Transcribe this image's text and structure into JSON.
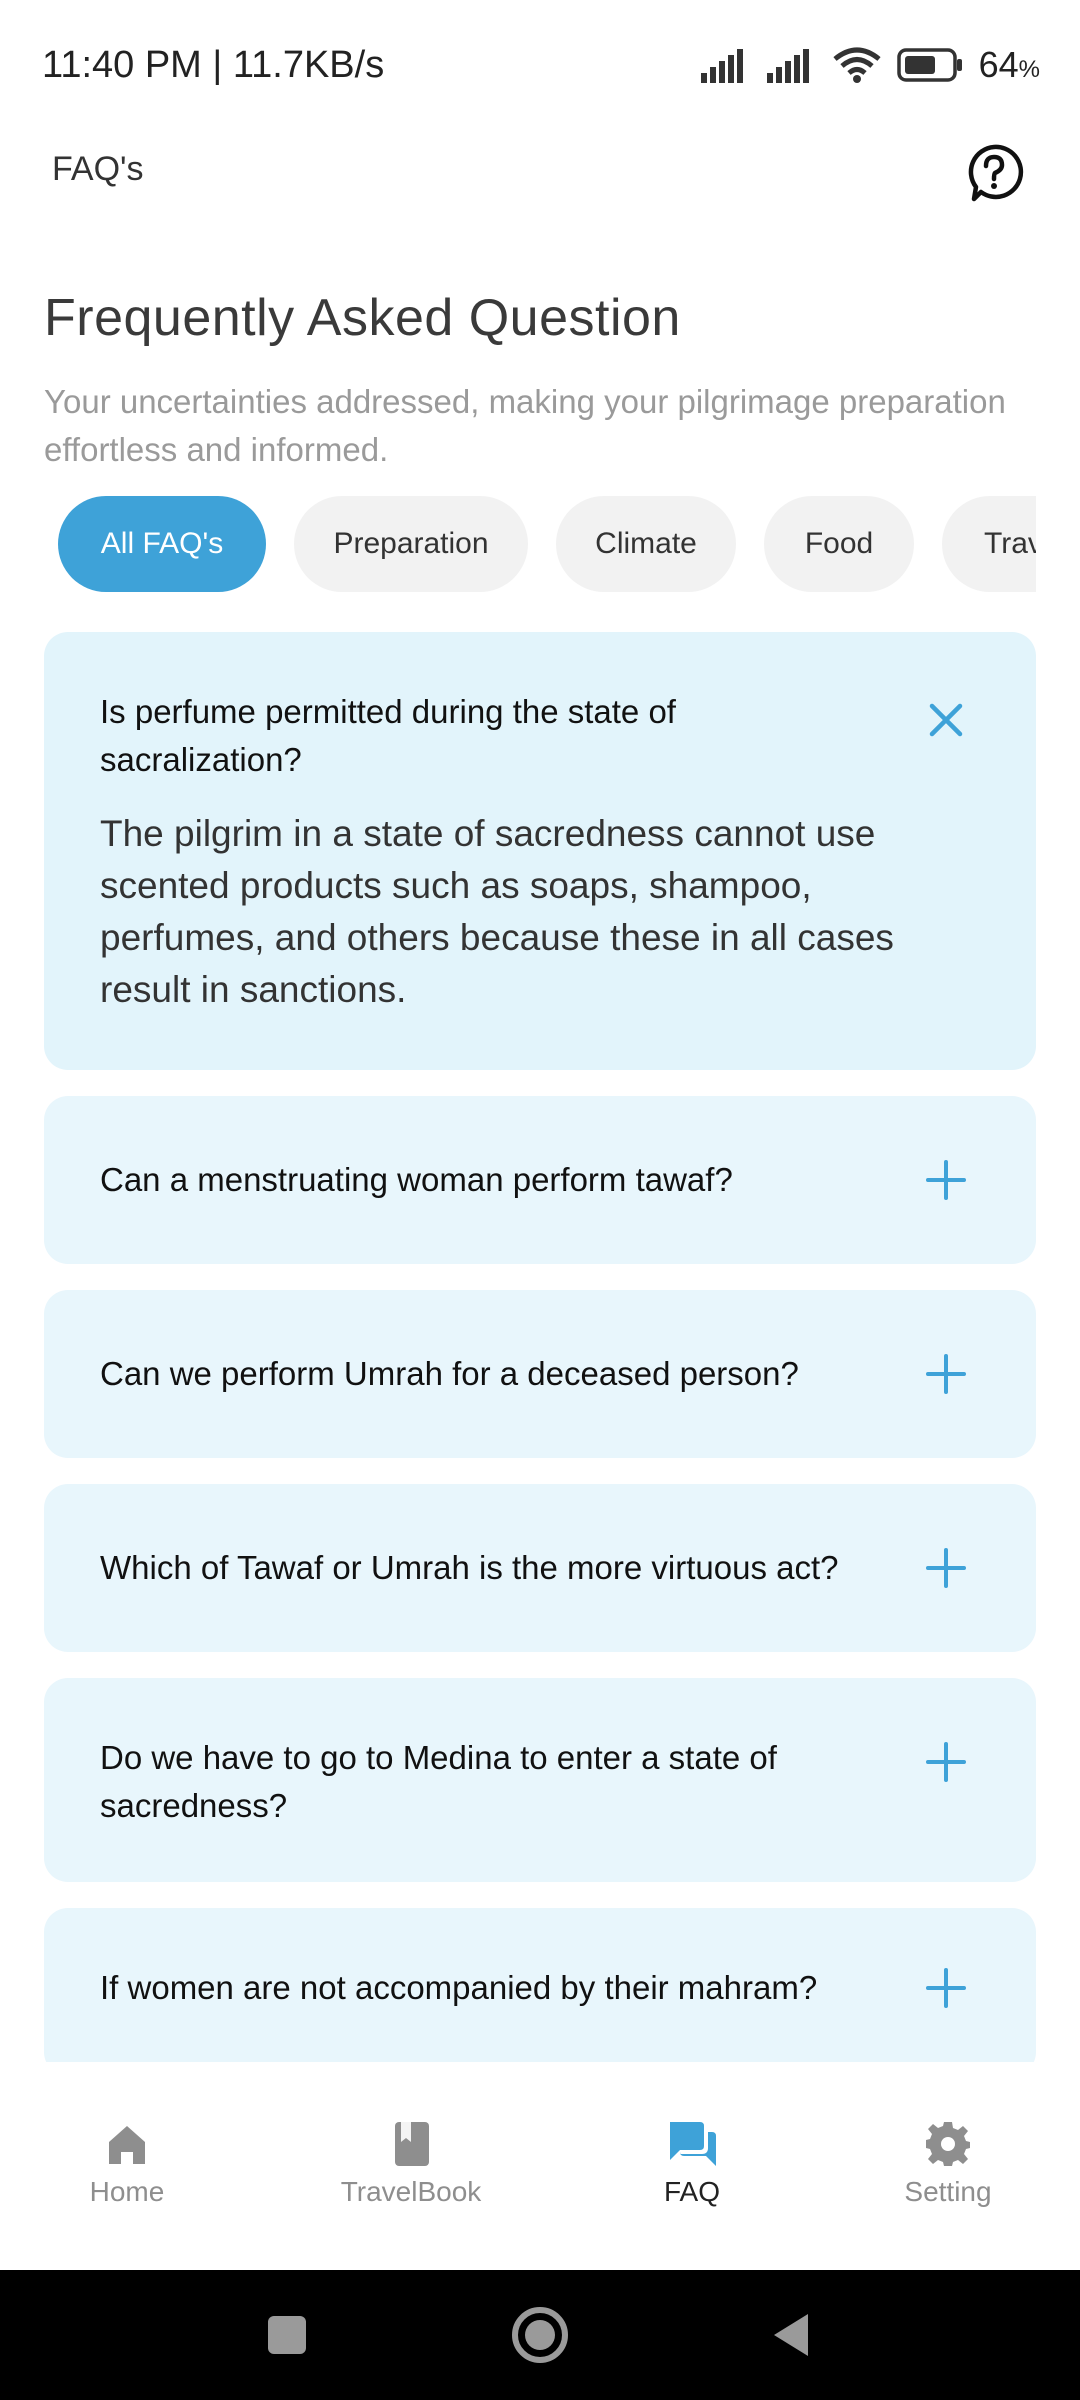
{
  "status_bar": {
    "time": "11:40 PM | 11.7KB/s",
    "battery": "64",
    "battery_unit": "%"
  },
  "header": {
    "title": "FAQ's",
    "help_icon": "help-circle-icon"
  },
  "title_section": {
    "title": "Frequently Asked Question",
    "subtitle": "Your uncertainties addressed, making your pilgrimage preparation effortless and informed."
  },
  "categories": [
    {
      "label": "All FAQ's",
      "active": true
    },
    {
      "label": "Preparation",
      "active": false
    },
    {
      "label": "Climate",
      "active": false
    },
    {
      "label": "Food",
      "active": false
    },
    {
      "label": "Travel",
      "active": false
    }
  ],
  "faqs": [
    {
      "question_line1": "Is perfume permitted during the state of",
      "question_line2": "sacralization?",
      "answer": "The pilgrim in a state of sacredness cannot use scented products such as soaps, shampoo, perfumes, and others because these in all cases result in sanctions.",
      "expanded": true
    },
    {
      "question": "Can a menstruating woman perform tawaf?",
      "expanded": false
    },
    {
      "question": "Can we perform Umrah for a deceased person?",
      "expanded": false
    },
    {
      "question": "Which of Tawaf or Umrah is the more virtuous act?",
      "expanded": false
    },
    {
      "question_line1": "Do we have to go to Medina to enter a state of",
      "question_line2": "sacredness?",
      "expanded": false
    },
    {
      "question": "If women are not accompanied by their mahram?",
      "expanded": false
    }
  ],
  "bottom_nav": [
    {
      "label": "Home",
      "icon": "home-icon",
      "active": false
    },
    {
      "label": "TravelBook",
      "icon": "book-icon",
      "active": false
    },
    {
      "label": "FAQ",
      "icon": "chat-icon",
      "active": true
    },
    {
      "label": "Setting",
      "icon": "gear-icon",
      "active": false
    }
  ],
  "colors": {
    "accent": "#3ea2d8",
    "card_bg": "#e8f6fc",
    "chip_bg": "#f2f2f2"
  }
}
